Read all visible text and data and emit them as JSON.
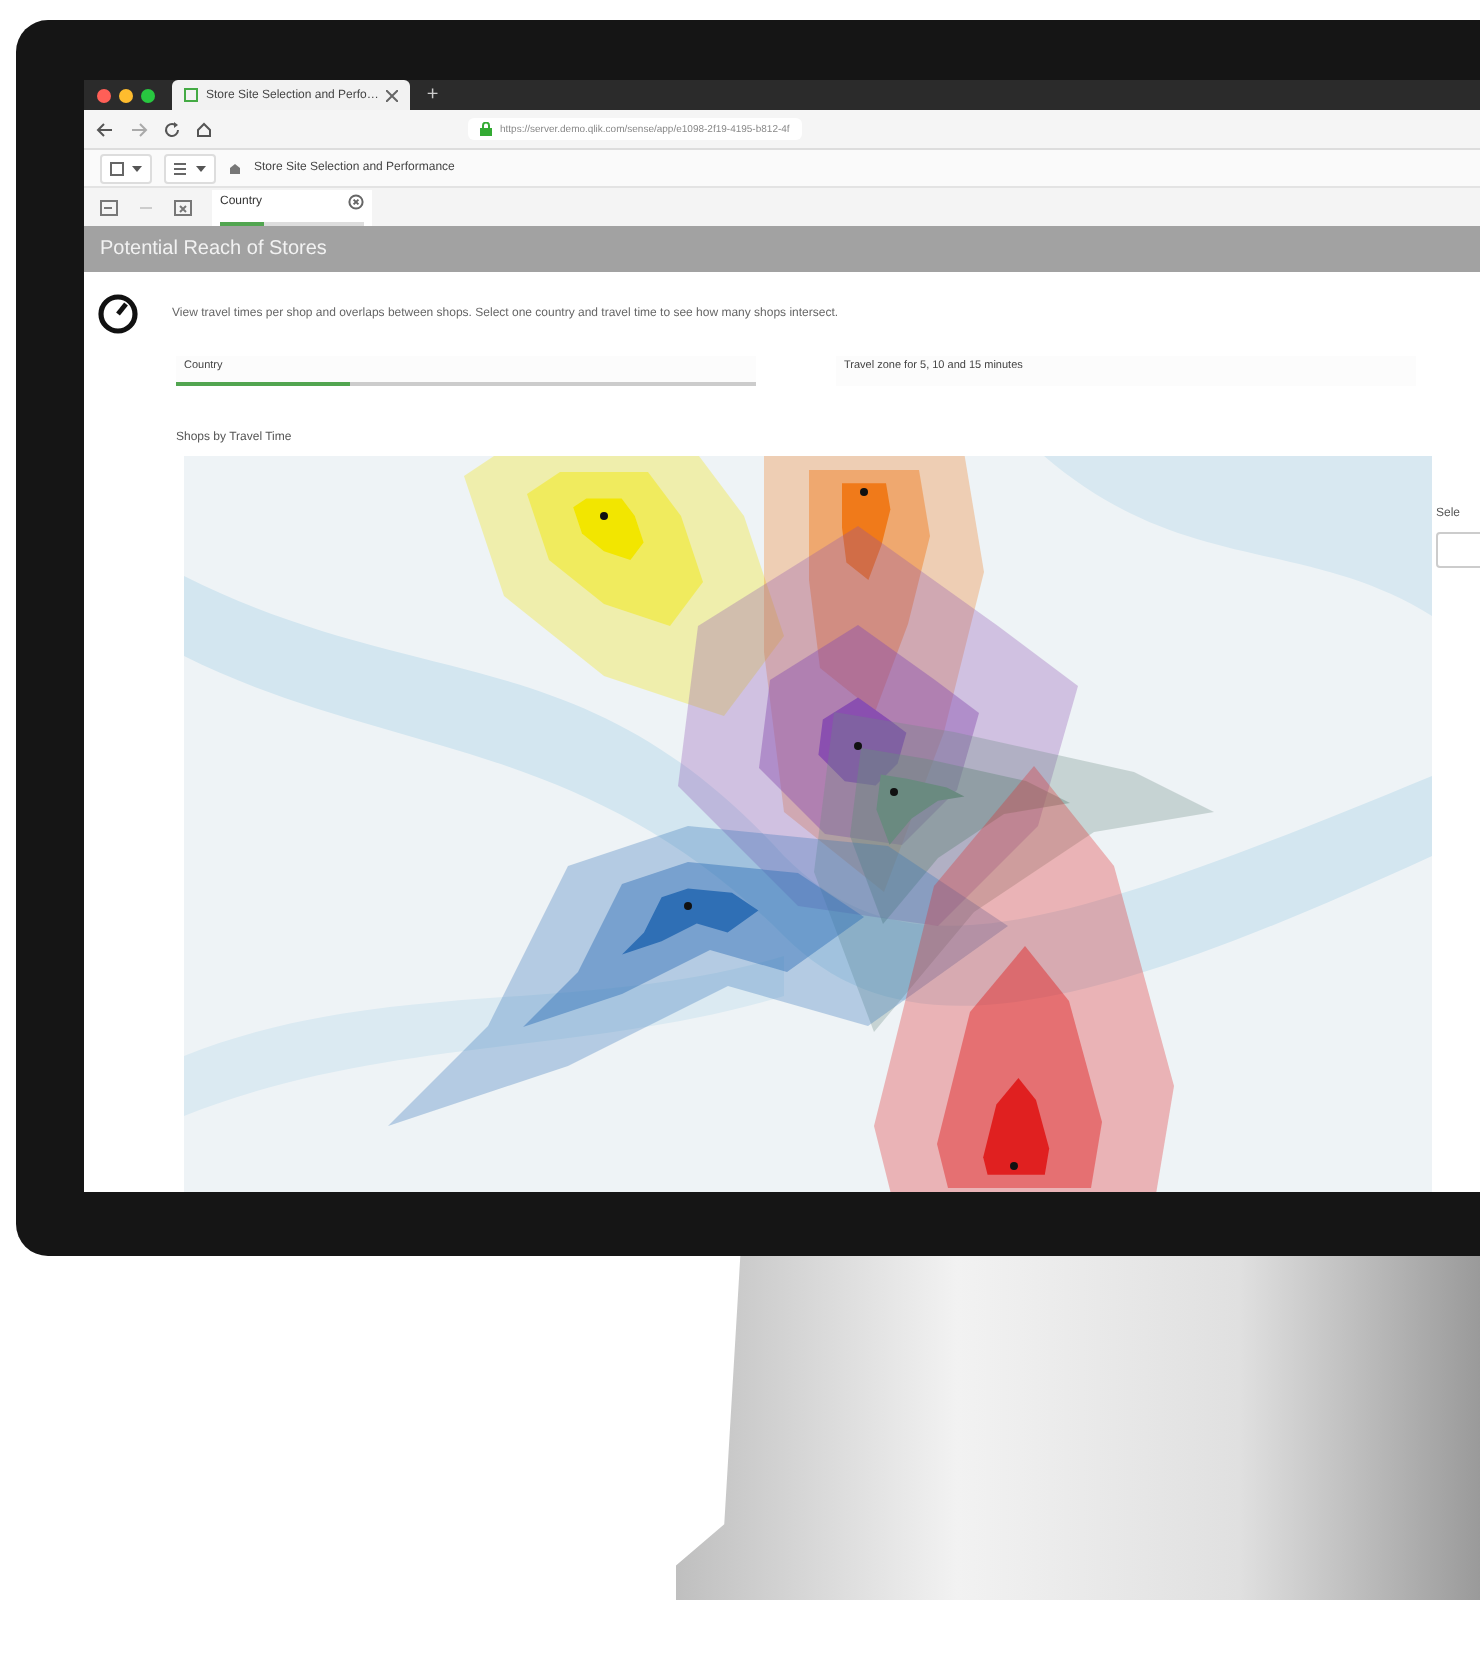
{
  "browser": {
    "tabs": [
      {
        "label": "Store Site Selection and Perfo…",
        "selected": true
      }
    ],
    "new_tab": "+",
    "url": "https://server.demo.qlik.com/sense/app/e1098-2f19-4195-b812-4f"
  },
  "app_toolbar": {
    "app_title": "Store Site Selection and Performance"
  },
  "selections": [
    {
      "field": "Country",
      "level": 0.3
    }
  ],
  "sheet": {
    "title": "Potential Reach of Stores",
    "description": "View travel times per shop and overlaps between shops. Select one country and travel time to see how many shops intersect.",
    "filters": [
      {
        "label": "Country",
        "kind": "selected",
        "level": 0.3
      },
      {
        "label": "Travel zone for 5, 10 and 15 minutes",
        "kind": "plain"
      }
    ],
    "map_title": "Shops by Travel Time",
    "shops": [
      {
        "color": "#f2e600"
      },
      {
        "color": "#f07a1a"
      },
      {
        "color": "#8a4fb0"
      },
      {
        "color": "#6a8a80"
      },
      {
        "color": "#2f6fb5"
      },
      {
        "color": "#e02020"
      }
    ],
    "side_label": "Sele"
  }
}
